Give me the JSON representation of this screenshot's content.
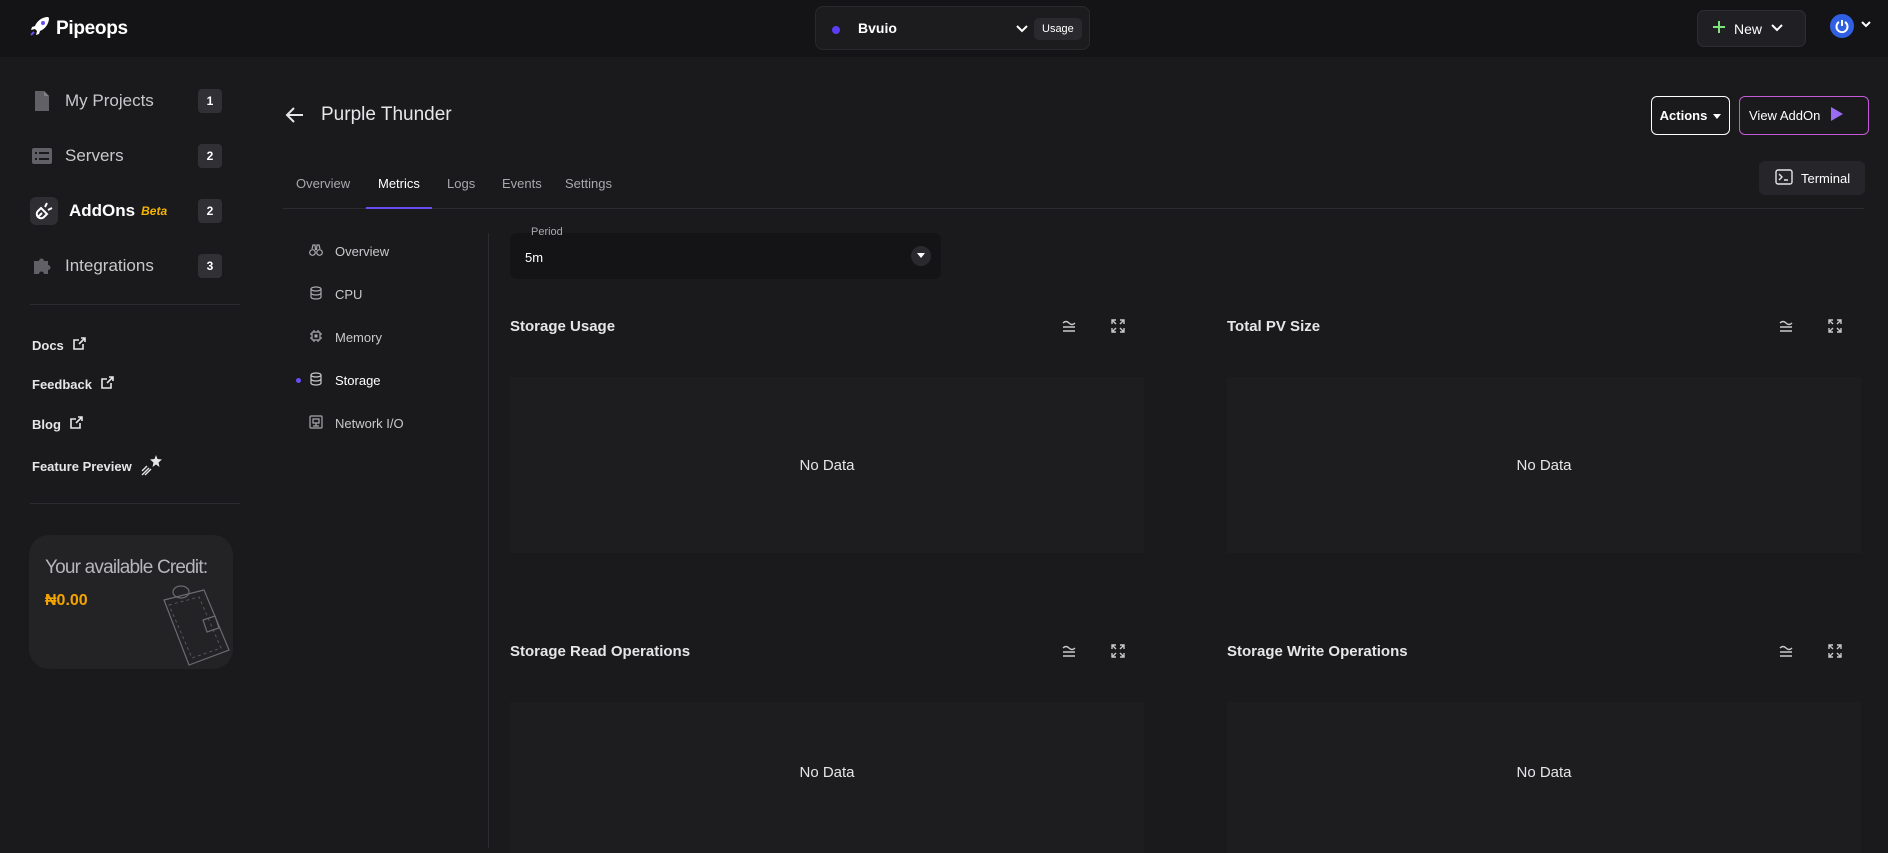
{
  "header": {
    "logo_text": "Pipeops",
    "project_name": "Bvuio",
    "usage_label": "Usage",
    "new_label": "New"
  },
  "sidebar": {
    "items": [
      {
        "label": "My Projects",
        "count": "1",
        "icon": "file-icon"
      },
      {
        "label": "Servers",
        "count": "2",
        "icon": "server-icon"
      },
      {
        "label": "AddOns",
        "badge": "Beta",
        "count": "2",
        "icon": "plug-icon"
      },
      {
        "label": "Integrations",
        "count": "3",
        "icon": "puzzle-icon"
      }
    ],
    "links": [
      {
        "label": "Docs"
      },
      {
        "label": "Feedback"
      },
      {
        "label": "Blog"
      },
      {
        "label": "Feature Preview"
      }
    ],
    "credit": {
      "label": "Your available Credit:",
      "value": "₦0.00"
    }
  },
  "page": {
    "title": "Purple Thunder",
    "actions_label": "Actions",
    "view_addon_label": "View AddOn",
    "terminal_label": "Terminal",
    "tabs": [
      "Overview",
      "Metrics",
      "Logs",
      "Events",
      "Settings"
    ],
    "active_tab": "Metrics"
  },
  "metrics_menu": {
    "items": [
      "Overview",
      "CPU",
      "Memory",
      "Storage",
      "Network I/O"
    ],
    "active": "Storage"
  },
  "period": {
    "label": "Period",
    "value": "5m"
  },
  "panels": [
    {
      "title": "Storage Usage",
      "empty_text": "No Data"
    },
    {
      "title": "Total PV Size",
      "empty_text": "No Data"
    },
    {
      "title": "Storage Read Operations",
      "empty_text": "No Data"
    },
    {
      "title": "Storage Write Operations",
      "empty_text": "No Data"
    }
  ],
  "colors": {
    "accent": "#6a4cf5",
    "credit": "#f5a400",
    "beta": "#f5b400"
  }
}
